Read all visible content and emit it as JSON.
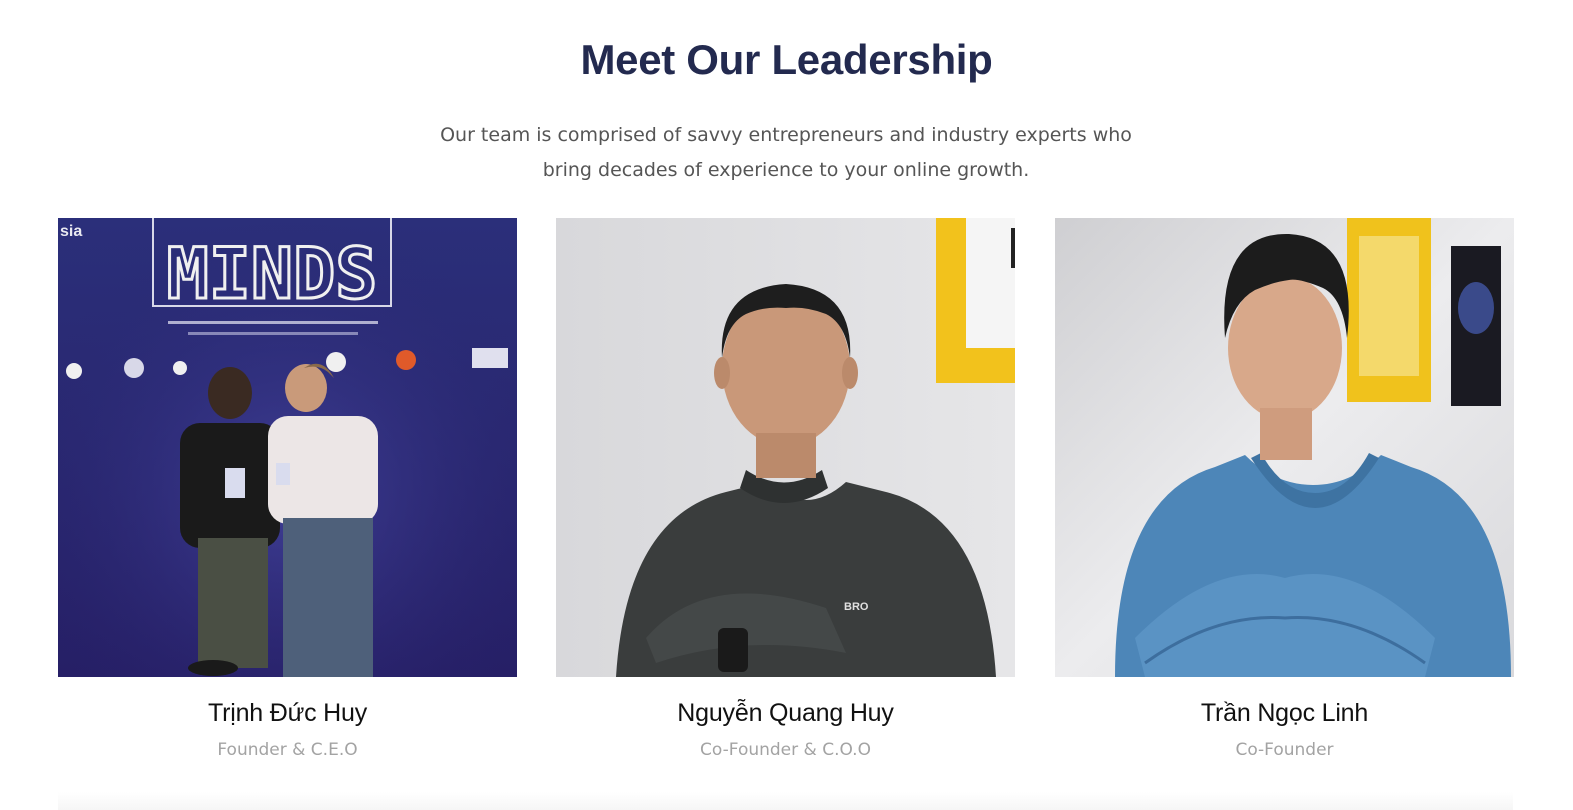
{
  "section": {
    "title": "Meet Our Leadership",
    "subtitle": "Our team is comprised of savvy entrepreneurs and industry experts who bring decades of experience to your online growth."
  },
  "team": [
    {
      "name": "Trịnh Đức Huy",
      "role": "Founder & C.E.O",
      "photo_banner_text": "MINDS",
      "photo_corner_text": "sia"
    },
    {
      "name": "Nguyễn Quang Huy",
      "role": "Co-Founder & C.O.O",
      "photo_shirt_text": "BRO"
    },
    {
      "name": "Trần Ngọc Linh",
      "role": "Co-Founder"
    }
  ],
  "colors": {
    "title": "#232a4f",
    "subtitle": "#555555",
    "name": "#111111",
    "role": "#a3a3a3"
  }
}
